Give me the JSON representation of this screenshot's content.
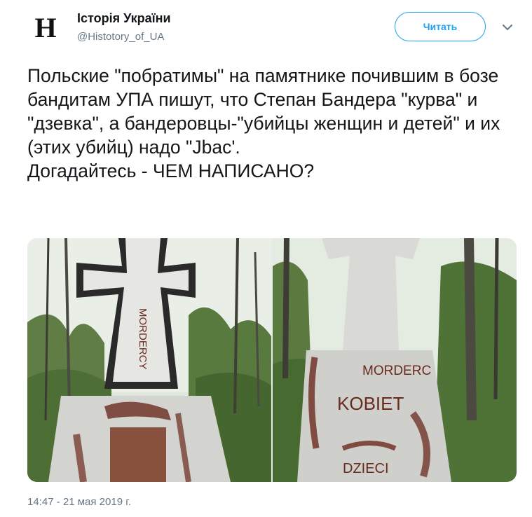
{
  "account": {
    "avatar_letter": "H",
    "name": "Історія України",
    "handle": "@Histotory_of_UA"
  },
  "actions": {
    "follow_label": "Читать",
    "menu_icon": "chevron-down-icon"
  },
  "tweet": {
    "text": "Польские \"побратимы\" на памятнике почившим в бозе бандитам УПА пишут, что Степан Бандера \"курва\" и \"дзевка\", а бандеровцы-\"убийцы женщин и детей\" и их (этих убийц) надо \"Jbac'.\nДогадайтесь - ЧЕМ НАПИСАНО?",
    "timestamp": "14:47 - 21 мая 2019 г."
  },
  "media": {
    "photo_left": {
      "graffiti": "MORDERCY"
    },
    "photo_right": {
      "graffiti": [
        "MORDERC",
        "KOBIET",
        "DZIECI"
      ]
    }
  },
  "colors": {
    "accent": "#1da1f2",
    "text_primary": "#14171a",
    "text_secondary": "#657786",
    "graffiti": "#6b2a1e"
  }
}
